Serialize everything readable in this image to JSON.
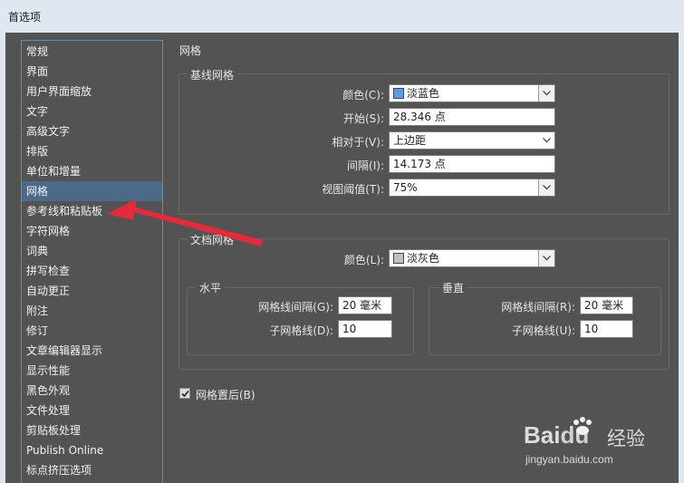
{
  "window": {
    "title": "首选项"
  },
  "sidebar": {
    "active_index": 7,
    "items": [
      {
        "label": "常规"
      },
      {
        "label": "界面"
      },
      {
        "label": "用户界面缩放"
      },
      {
        "label": "文字"
      },
      {
        "label": "高级文字"
      },
      {
        "label": "排版"
      },
      {
        "label": "单位和增量"
      },
      {
        "label": "网格"
      },
      {
        "label": "参考线和粘贴板"
      },
      {
        "label": "字符网格"
      },
      {
        "label": "词典"
      },
      {
        "label": "拼写检查"
      },
      {
        "label": "自动更正"
      },
      {
        "label": "附注"
      },
      {
        "label": "修订"
      },
      {
        "label": "文章编辑器显示"
      },
      {
        "label": "显示性能"
      },
      {
        "label": "黑色外观"
      },
      {
        "label": "文件处理"
      },
      {
        "label": "剪贴板处理"
      },
      {
        "label": "Publish Online"
      },
      {
        "label": "标点挤压选项"
      }
    ]
  },
  "panel": {
    "title": "网格",
    "baseline": {
      "title": "基线网格",
      "color_label": "颜色(C):",
      "color_value": "淡蓝色",
      "color_swatch": "#5b9bf0",
      "start_label": "开始(S):",
      "start_value": "28.346 点",
      "relative_label": "相对于(V):",
      "relative_value": "上边距",
      "increment_label": "间隔(I):",
      "increment_value": "14.173 点",
      "threshold_label": "视图阈值(T):",
      "threshold_value": "75%"
    },
    "document": {
      "title": "文档网格",
      "color_label": "颜色(L):",
      "color_value": "淡灰色",
      "color_swatch": "#c0c0c0",
      "horizontal": {
        "title": "水平",
        "gridline_label": "网格线间隔(G):",
        "gridline_value": "20 毫米",
        "subdiv_label": "子网格线(D):",
        "subdiv_value": "10"
      },
      "vertical": {
        "title": "垂直",
        "gridline_label": "网格线间隔(R):",
        "gridline_value": "20 毫米",
        "subdiv_label": "子网格线(U):",
        "subdiv_value": "10"
      }
    },
    "grids_in_back": {
      "label": "网格置后(B)",
      "checked": true
    }
  },
  "watermark": {
    "brand": "Bai",
    "brand2": "du",
    "suffix": "经验",
    "url": "jingyan.baidu.com"
  },
  "colors": {
    "accent": "#5b8fc9",
    "arrow": "#e8293a",
    "selected": "#4b6a8a"
  }
}
